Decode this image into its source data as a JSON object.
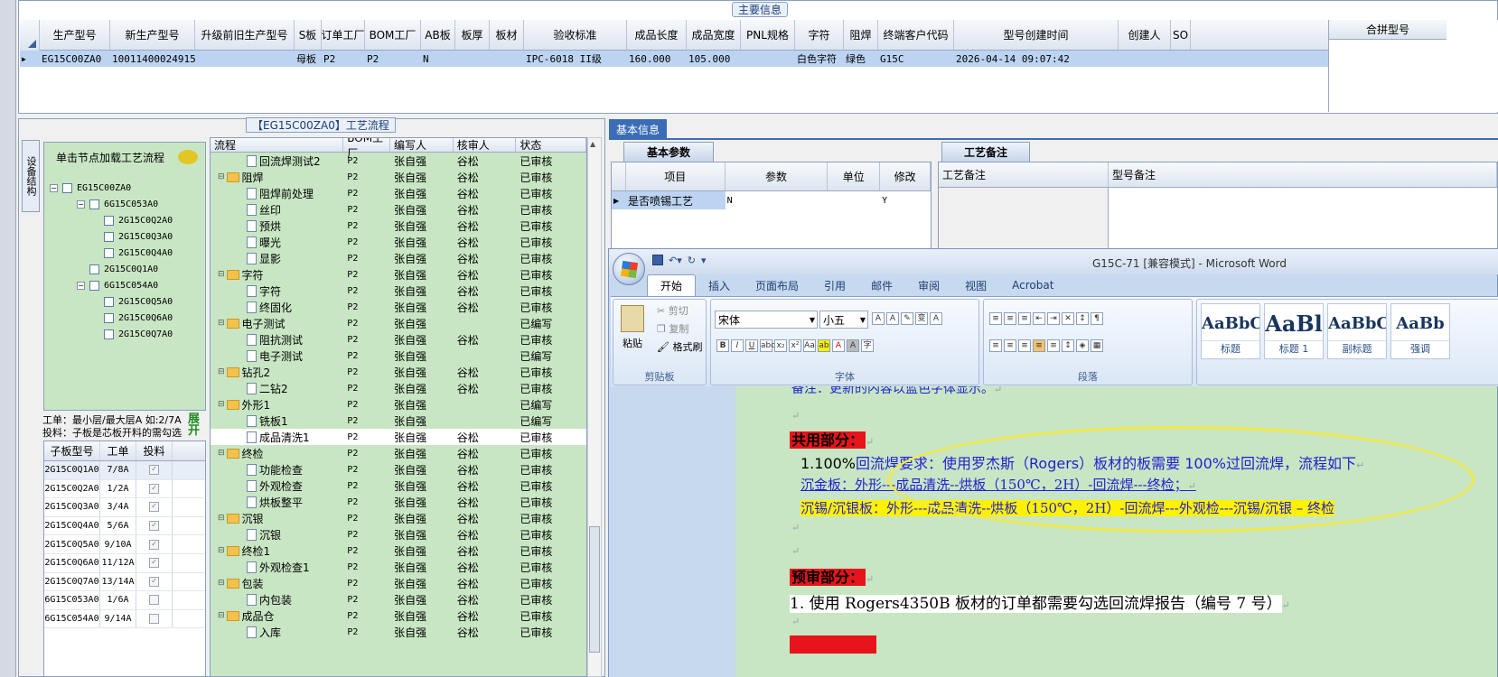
{
  "top": {
    "section_title": "主要信息",
    "columns": [
      "生产型号",
      "新生产型号",
      "升级前旧生产型号",
      "S板",
      "订单工厂",
      "BOM工厂",
      "AB板",
      "板厚",
      "板材",
      "验收标准",
      "成品长度",
      "成品宽度",
      "PNL规格",
      "字符",
      "阻焊",
      "终端客户代码",
      "型号创建时间",
      "创建人",
      "SO"
    ],
    "row": [
      "EG15C00ZA0",
      "10011400024915",
      "",
      "母板",
      "P2",
      "P2",
      "N",
      "",
      "",
      "IPC-6018 II级",
      "160.000",
      "105.000",
      "",
      "白色字符",
      "绿色",
      "G15C",
      "2026-04-14 09:07:42",
      "",
      ""
    ],
    "merge_header": "合拼型号"
  },
  "process": {
    "title": "【EG15C00ZA0】工艺流程",
    "vtab_label": "设备结构",
    "tree_header": "单击节点加载工艺流程",
    "tree_nodes": [
      "EG15C00ZA0",
      "6G15C053A0",
      "2G15C0Q2A0",
      "2G15C0Q3A0",
      "2G15C0Q4A0",
      "2G15C0Q1A0",
      "6G15C054A0",
      "2G15C0Q5A0",
      "2G15C0Q6A0",
      "2G15C0Q7A0"
    ],
    "work_info_1": "工单：最小层/最大层A 如:2/7A",
    "work_info_2": "投料：子板是芯板开料的需勾选",
    "expand_label": "展开",
    "sub_columns": [
      "子板型号",
      "工单",
      "投料"
    ],
    "sub_rows": [
      {
        "model": "2G15C0Q1A0",
        "order": "7/8A",
        "checked": true
      },
      {
        "model": "2G15C0Q2A0",
        "order": "1/2A",
        "checked": true
      },
      {
        "model": "2G15C0Q3A0",
        "order": "3/4A",
        "checked": true
      },
      {
        "model": "2G15C0Q4A0",
        "order": "5/6A",
        "checked": true
      },
      {
        "model": "2G15C0Q5A0",
        "order": "9/10A",
        "checked": true
      },
      {
        "model": "2G15C0Q6A0",
        "order": "11/12A",
        "checked": true
      },
      {
        "model": "2G15C0Q7A0",
        "order": "13/14A",
        "checked": true
      },
      {
        "model": "6G15C053A0",
        "order": "1/6A",
        "checked": false
      },
      {
        "model": "6G15C054A0",
        "order": "9/14A",
        "checked": false
      }
    ],
    "flow_columns": [
      "流程",
      "BOM工厂",
      "编写人",
      "核审人",
      "状态"
    ],
    "flow_rows": [
      {
        "name": "回流焊测试2",
        "lvl": 1,
        "bom": "P2",
        "writer": "张自强",
        "reviewer": "谷松",
        "status": "已审核"
      },
      {
        "name": "阻焊",
        "lvl": 0,
        "bom": "P2",
        "writer": "张自强",
        "reviewer": "谷松",
        "status": "已审核"
      },
      {
        "name": "阻焊前处理",
        "lvl": 1,
        "bom": "P2",
        "writer": "张自强",
        "reviewer": "谷松",
        "status": "已审核"
      },
      {
        "name": "丝印",
        "lvl": 1,
        "bom": "P2",
        "writer": "张自强",
        "reviewer": "谷松",
        "status": "已审核"
      },
      {
        "name": "预烘",
        "lvl": 1,
        "bom": "P2",
        "writer": "张自强",
        "reviewer": "谷松",
        "status": "已审核"
      },
      {
        "name": "曝光",
        "lvl": 1,
        "bom": "P2",
        "writer": "张自强",
        "reviewer": "谷松",
        "status": "已审核"
      },
      {
        "name": "显影",
        "lvl": 1,
        "bom": "P2",
        "writer": "张自强",
        "reviewer": "谷松",
        "status": "已审核"
      },
      {
        "name": "字符",
        "lvl": 0,
        "bom": "P2",
        "writer": "张自强",
        "reviewer": "谷松",
        "status": "已审核"
      },
      {
        "name": "字符",
        "lvl": 1,
        "bom": "P2",
        "writer": "张自强",
        "reviewer": "谷松",
        "status": "已审核"
      },
      {
        "name": "终固化",
        "lvl": 1,
        "bom": "P2",
        "writer": "张自强",
        "reviewer": "谷松",
        "status": "已审核"
      },
      {
        "name": "电子测试",
        "lvl": 0,
        "bom": "P2",
        "writer": "张自强",
        "reviewer": "",
        "status": "已编写"
      },
      {
        "name": "阻抗测试",
        "lvl": 1,
        "bom": "P2",
        "writer": "张自强",
        "reviewer": "谷松",
        "status": "已审核"
      },
      {
        "name": "电子测试",
        "lvl": 1,
        "bom": "P2",
        "writer": "张自强",
        "reviewer": "",
        "status": "已编写"
      },
      {
        "name": "钻孔2",
        "lvl": 0,
        "bom": "P2",
        "writer": "张自强",
        "reviewer": "谷松",
        "status": "已审核"
      },
      {
        "name": "二钻2",
        "lvl": 1,
        "bom": "P2",
        "writer": "张自强",
        "reviewer": "谷松",
        "status": "已审核"
      },
      {
        "name": "外形1",
        "lvl": 0,
        "bom": "P2",
        "writer": "张自强",
        "reviewer": "",
        "status": "已编写"
      },
      {
        "name": "铣板1",
        "lvl": 1,
        "bom": "P2",
        "writer": "张自强",
        "reviewer": "",
        "status": "已编写"
      },
      {
        "name": "成品清洗1",
        "lvl": 1,
        "bom": "P2",
        "writer": "张自强",
        "reviewer": "谷松",
        "status": "已审核",
        "selected": true
      },
      {
        "name": "终检",
        "lvl": 0,
        "bom": "P2",
        "writer": "张自强",
        "reviewer": "谷松",
        "status": "已审核"
      },
      {
        "name": "功能检查",
        "lvl": 1,
        "bom": "P2",
        "writer": "张自强",
        "reviewer": "谷松",
        "status": "已审核"
      },
      {
        "name": "外观检查",
        "lvl": 1,
        "bom": "P2",
        "writer": "张自强",
        "reviewer": "谷松",
        "status": "已审核"
      },
      {
        "name": "烘板整平",
        "lvl": 1,
        "bom": "P2",
        "writer": "张自强",
        "reviewer": "谷松",
        "status": "已审核"
      },
      {
        "name": "沉银",
        "lvl": 0,
        "bom": "P2",
        "writer": "张自强",
        "reviewer": "谷松",
        "status": "已审核"
      },
      {
        "name": "沉银",
        "lvl": 1,
        "bom": "P2",
        "writer": "张自强",
        "reviewer": "谷松",
        "status": "已审核"
      },
      {
        "name": "终检1",
        "lvl": 0,
        "bom": "P2",
        "writer": "张自强",
        "reviewer": "谷松",
        "status": "已审核"
      },
      {
        "name": "外观检查1",
        "lvl": 1,
        "bom": "P2",
        "writer": "张自强",
        "reviewer": "谷松",
        "status": "已审核"
      },
      {
        "name": "包装",
        "lvl": 0,
        "bom": "P2",
        "writer": "张自强",
        "reviewer": "谷松",
        "status": "已审核"
      },
      {
        "name": "内包装",
        "lvl": 1,
        "bom": "P2",
        "writer": "张自强",
        "reviewer": "谷松",
        "status": "已审核"
      },
      {
        "name": "成品仓",
        "lvl": 0,
        "bom": "P2",
        "writer": "张自强",
        "reviewer": "谷松",
        "status": "已审核"
      },
      {
        "name": "入库",
        "lvl": 1,
        "bom": "P2",
        "writer": "张自强",
        "reviewer": "谷松",
        "status": "已审核"
      }
    ]
  },
  "basic": {
    "tab": "基本信息",
    "param_tab": "基本参数",
    "param_columns": [
      "项目",
      "参数",
      "单位",
      "修改"
    ],
    "param_row": [
      "是否喷锡工艺",
      "N",
      "",
      "Y"
    ],
    "note_tab": "工艺备注",
    "note_columns": [
      "工艺备注",
      "型号备注"
    ]
  },
  "word": {
    "caption": "G15C-71 [兼容模式] - Microsoft Word",
    "tabs": [
      "开始",
      "插入",
      "页面布局",
      "引用",
      "邮件",
      "审阅",
      "视图",
      "Acrobat"
    ],
    "clipboard": {
      "paste": "粘贴",
      "cut": "剪切",
      "copy": "复制",
      "format": "格式刷",
      "label": "剪贴板"
    },
    "font": {
      "name": "宋体",
      "size": "小五",
      "label": "字体"
    },
    "paragraph_label": "段落",
    "styles": [
      {
        "sample": "AaBbC",
        "name": "标题"
      },
      {
        "sample": "AaBl",
        "name": "标题 1"
      },
      {
        "sample": "AaBbC",
        "name": "副标题"
      },
      {
        "sample": "AaBb",
        "name": "强调"
      }
    ],
    "doc": {
      "line0": "备注：更新的内容以蓝色字体显示。",
      "h1": "共用部分：",
      "l1a": "1.100%",
      "l1b": "回流焊要求：使用罗杰斯（Rogers）板材的板需要 ",
      "l1c": "100%",
      "l1d": "过回流焊，流程如下",
      "l2": "沉金板：外形---成品清洗--烘板（150℃，2H）-回流焊---终检；",
      "l3": "沉锡/沉银板：外形---成品清洗--烘板（150℃，2H）-回流焊---外观检---沉锡/沉银 – 终检",
      "h2": "预审部分：",
      "l4": "1.  使用 Rogers4350B 板材的订单都需要勾选回流焊报告（编号 7 号）"
    }
  }
}
